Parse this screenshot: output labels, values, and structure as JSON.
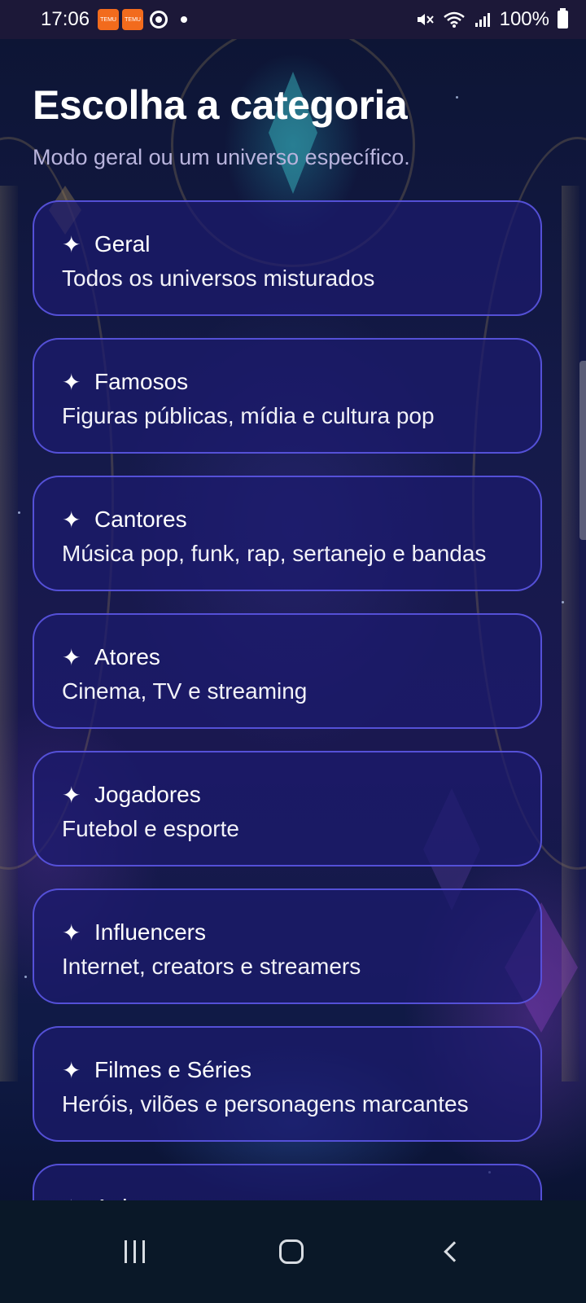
{
  "status_bar": {
    "time": "17:06",
    "app_icon_text": "TEMU",
    "battery": "100%"
  },
  "header": {
    "title": "Escolha a categoria",
    "subtitle": "Modo geral ou um universo específico."
  },
  "categories": [
    {
      "icon": "sparkle-icon",
      "title": "Geral",
      "description": "Todos os universos misturados"
    },
    {
      "icon": "sparkle-icon",
      "title": "Famosos",
      "description": "Figuras públicas, mídia e cultura pop"
    },
    {
      "icon": "sparkle-icon",
      "title": "Cantores",
      "description": "Música pop, funk, rap, sertanejo e bandas"
    },
    {
      "icon": "sparkle-icon",
      "title": "Atores",
      "description": "Cinema, TV e streaming"
    },
    {
      "icon": "sparkle-icon",
      "title": "Jogadores",
      "description": "Futebol e esporte"
    },
    {
      "icon": "sparkle-icon",
      "title": "Influencers",
      "description": "Internet, creators e streamers"
    },
    {
      "icon": "sparkle-icon",
      "title": "Filmes e Séries",
      "description": "Heróis, vilões e personagens marcantes"
    },
    {
      "icon": "sparkle-icon",
      "title": "Anime",
      "description": ""
    }
  ],
  "colors": {
    "card_border": "#5f5aeb",
    "card_background": "#1c1a6e",
    "subtitle": "#b9b4dd",
    "status_bar": "#1c1838",
    "nav_bar": "#0a1828"
  }
}
